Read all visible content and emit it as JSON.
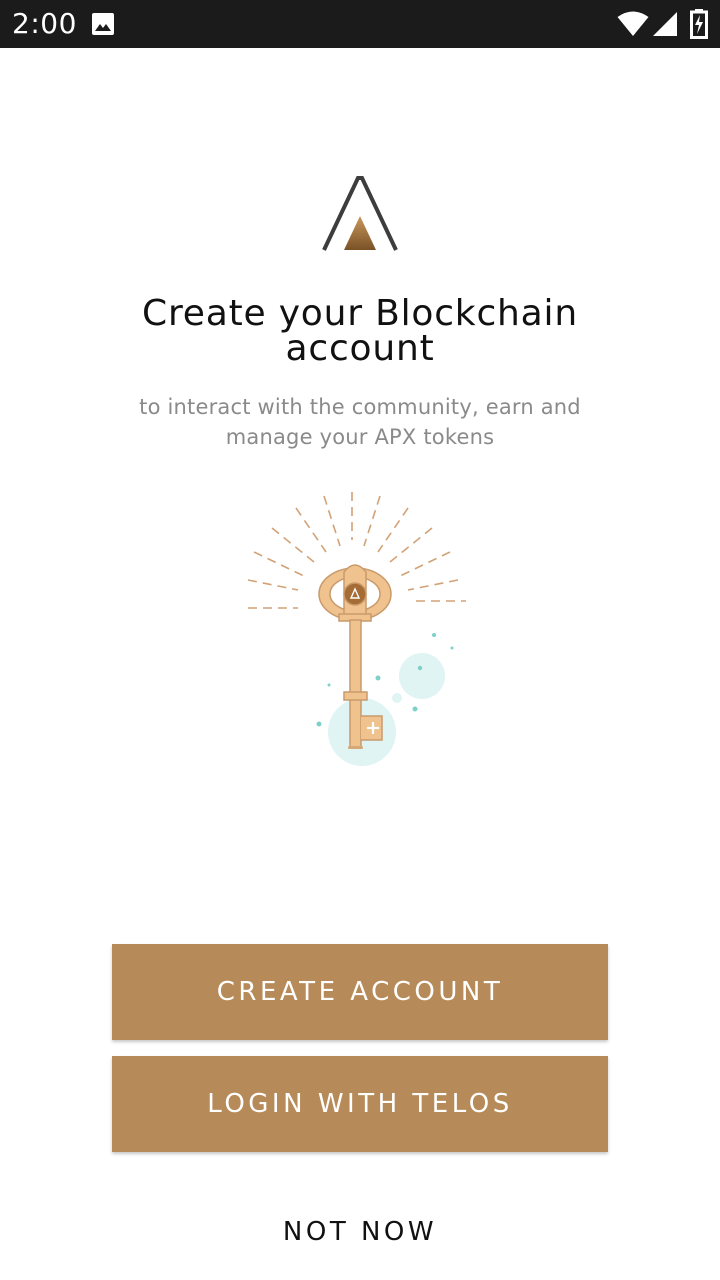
{
  "status_bar": {
    "time": "2:00",
    "icons": [
      "image-icon",
      "wifi-icon",
      "signal-icon",
      "battery-icon"
    ]
  },
  "header": {
    "title_line1": "Create your Blockchain",
    "title_line2": "account",
    "subtitle_line1": "to interact with the community, earn and",
    "subtitle_line2": "manage your APX tokens"
  },
  "actions": {
    "create_label": "CREATE ACCOUNT",
    "login_label": "LOGIN WITH TELOS",
    "skip_label": "NOT NOW"
  },
  "colors": {
    "accent": "#b78b59",
    "key": "#f0c28e",
    "bubble": "#dff4f3",
    "status_bar": "#1b1b1b"
  }
}
